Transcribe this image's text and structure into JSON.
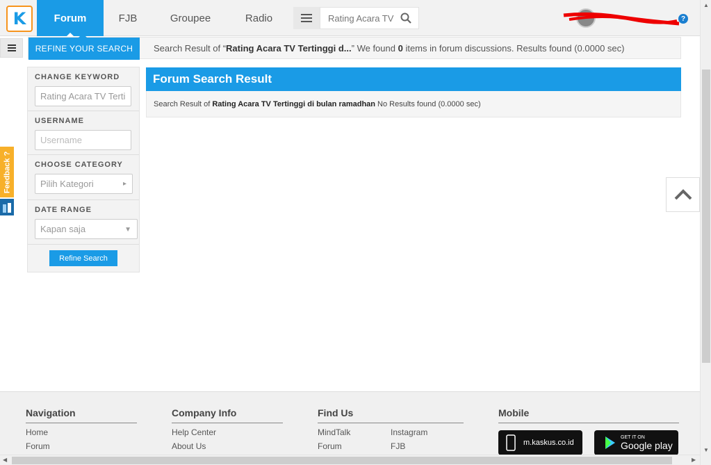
{
  "nav": {
    "logo": "K",
    "tabs": [
      {
        "label": "Forum",
        "active": true
      },
      {
        "label": "FJB",
        "active": false
      },
      {
        "label": "Groupee",
        "active": false
      },
      {
        "label": "Radio",
        "active": false
      }
    ],
    "search_value": "Rating Acara TV",
    "help_label": "?"
  },
  "results_bar": {
    "refine_tab": "REFINE YOUR SEARCH",
    "prefix": "Search Result of “",
    "query": "Rating Acara TV Tertinggi d...",
    "middle": "” We found ",
    "count": "0",
    "suffix": " items in forum discussions. Results found (0.0000 sec)"
  },
  "refine": {
    "keyword_label": "CHANGE KEYWORD",
    "keyword_value": "Rating Acara TV Terti",
    "username_label": "USERNAME",
    "username_placeholder": "Username",
    "category_label": "CHOOSE CATEGORY",
    "category_value": "Pilih Kategori",
    "date_label": "DATE RANGE",
    "date_value": "Kapan saja",
    "button": "Refine Search"
  },
  "result": {
    "title": "Forum Search Result",
    "prefix": "Search Result of",
    "query": "Rating Acara TV Tertinggi di bulan ramadhan",
    "suffix": "No Results found (0.0000 sec)"
  },
  "feedback": "Feedback ?",
  "footer": {
    "navigation": {
      "title": "Navigation",
      "links": [
        "Home",
        "Forum"
      ]
    },
    "company": {
      "title": "Company Info",
      "links": [
        "Help Center",
        "About Us"
      ]
    },
    "findus": {
      "title": "Find Us",
      "col1": [
        "MindTalk",
        "Forum"
      ],
      "col2": [
        "Instagram",
        "FJB"
      ]
    },
    "mobile": {
      "title": "Mobile",
      "app1": "m.kaskus.co.id",
      "app2_top": "GET IT ON",
      "app2_bottom": "Google play"
    }
  },
  "colors": {
    "accent": "#1a9be6",
    "feedback": "#f7b02a",
    "logo_border": "#f7941d"
  }
}
